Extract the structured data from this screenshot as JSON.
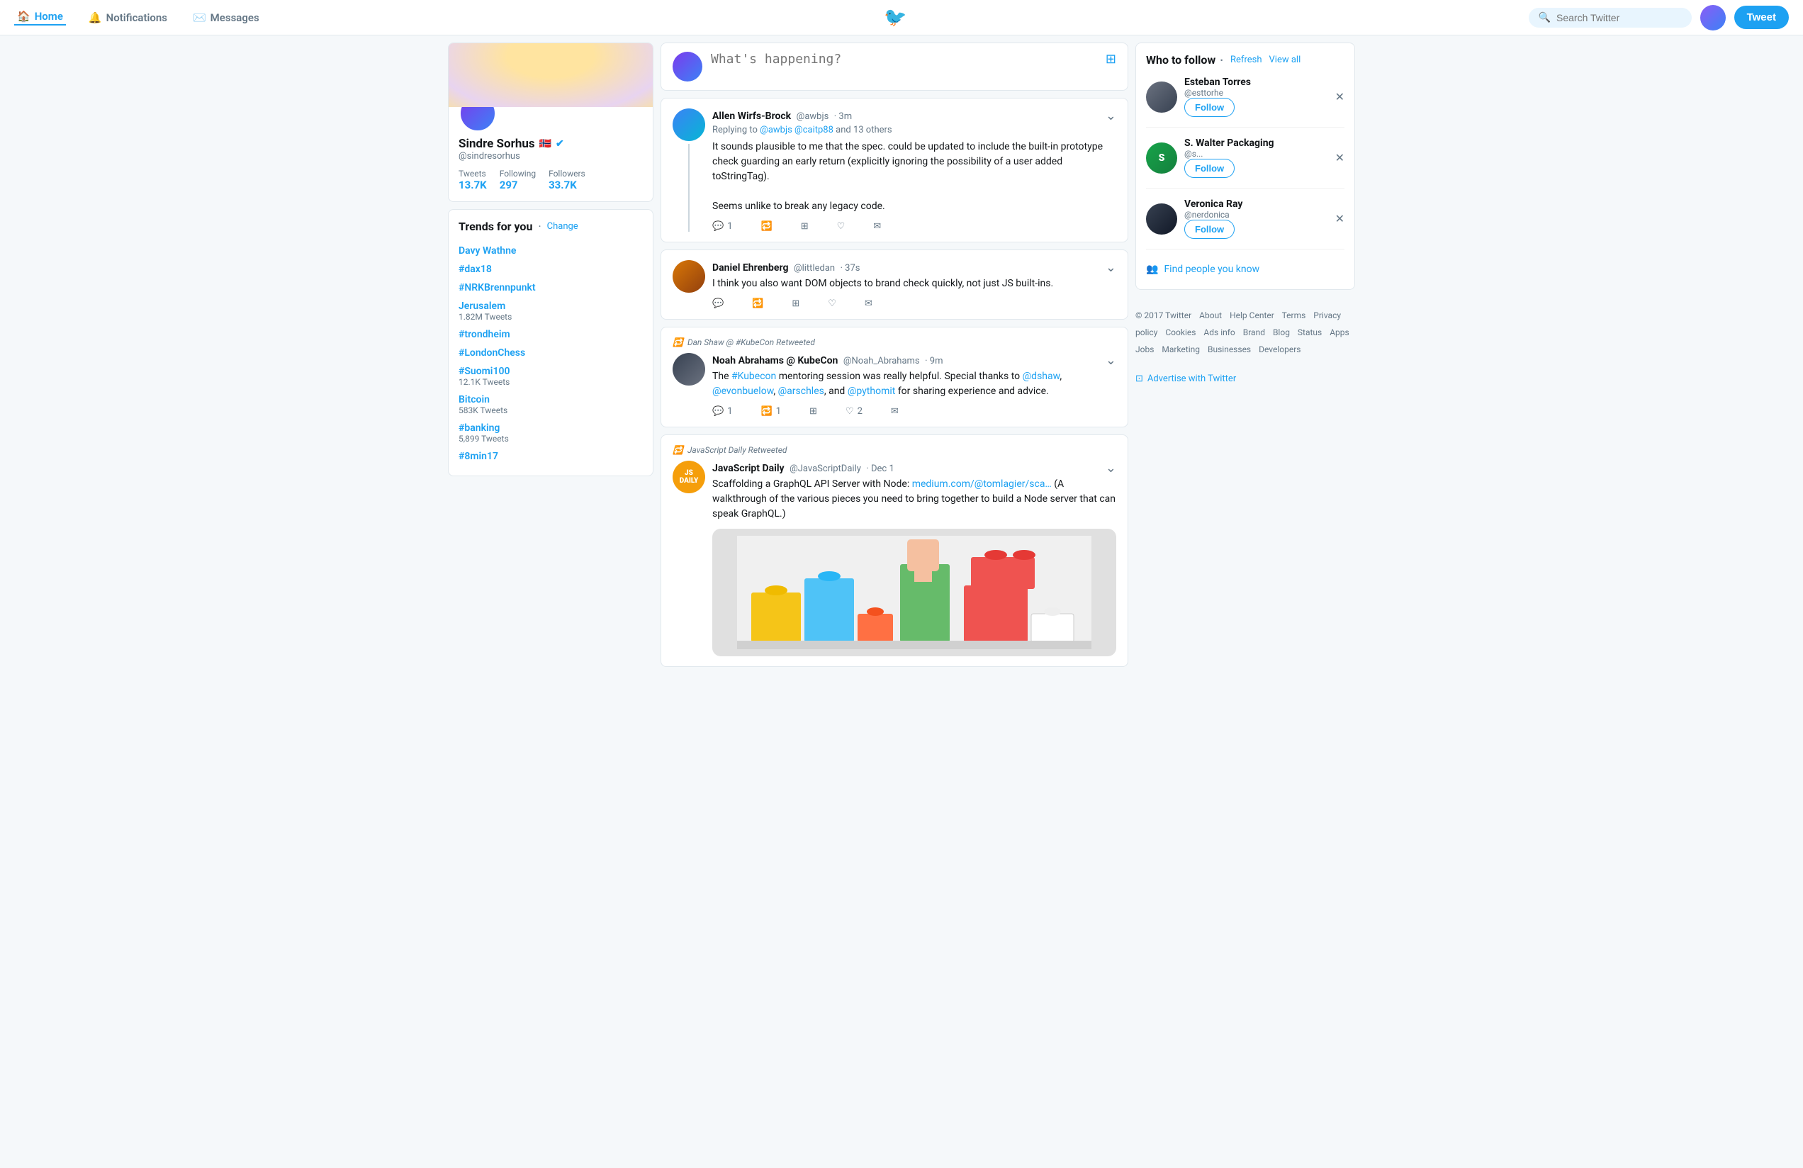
{
  "nav": {
    "home_label": "Home",
    "notifications_label": "Notifications",
    "messages_label": "Messages",
    "search_placeholder": "Search Twitter",
    "tweet_button_label": "Tweet"
  },
  "profile": {
    "name": "Sindre Sorhus",
    "handle": "@sindresorhus",
    "tweets_label": "Tweets",
    "tweets_count": "13.7K",
    "following_label": "Following",
    "following_count": "297",
    "followers_label": "Followers",
    "followers_count": "33.7K"
  },
  "trends": {
    "title": "Trends for you",
    "change_label": "Change",
    "items": [
      {
        "name": "Davy Wathne",
        "count": ""
      },
      {
        "name": "#dax18",
        "count": ""
      },
      {
        "name": "#NRKBrennpunkt",
        "count": ""
      },
      {
        "name": "Jerusalem",
        "count": "1.82M Tweets"
      },
      {
        "name": "#trondheim",
        "count": ""
      },
      {
        "name": "#LondonChess",
        "count": ""
      },
      {
        "name": "#Suomi100",
        "count": "12.1K Tweets"
      },
      {
        "name": "Bitcoin",
        "count": "583K Tweets"
      },
      {
        "name": "#banking",
        "count": "5,899 Tweets"
      },
      {
        "name": "#8min17",
        "count": ""
      }
    ]
  },
  "compose": {
    "placeholder": "What's happening?"
  },
  "tweets": [
    {
      "id": "tweet1",
      "author": "Allen Wirfs-Brock",
      "handle": "@awbjs",
      "time": "3m",
      "reply_to_text": "Replying to @awbjs @caitp88 and 13 others",
      "text": "It sounds plausible to me that the spec. could be updated to include the built-in prototype check guarding an early return (explicitly ignoring the possibility of a user added toStringTag).\n\nSeems unlike to break any legacy code.",
      "replies": "1",
      "retweets": "",
      "likes": "",
      "has_thread": true
    },
    {
      "id": "tweet2",
      "author": "Daniel Ehrenberg",
      "handle": "@littledan",
      "time": "37s",
      "text": "I think you also want DOM objects to brand check quickly, not just JS built-ins.",
      "replies": "",
      "retweets": "",
      "likes": "",
      "has_thread": false
    },
    {
      "id": "tweet3",
      "retweeted_by": "Dan Shaw @ #KubeCon Retweeted",
      "author": "Noah Abrahams @ KubeCon",
      "handle": "@Noah_Abrahams",
      "time": "9m",
      "text": "The #Kubecon mentoring session was really helpful. Special thanks to @dshaw, @evonbuelow, @arschles, and @pythomit for sharing experience and advice.",
      "replies": "1",
      "retweets": "1",
      "likes": "2",
      "has_thread": false
    },
    {
      "id": "tweet4",
      "retweeted_by": "JavaScript Daily Retweeted",
      "author": "JavaScript Daily",
      "handle": "@JavaScriptDaily",
      "time": "Dec 1",
      "text": "Scaffolding a GraphQL API Server with Node: medium.com/@tomlagier/sca… (A walkthrough of the various pieces you need to bring together to build a Node server that can speak GraphQL.)",
      "link_text": "medium.com/@tomlagier/sca…",
      "replies": "",
      "retweets": "",
      "likes": "",
      "has_image": true
    }
  ],
  "who_to_follow": {
    "title": "Who to follow",
    "refresh_label": "Refresh",
    "view_all_label": "View all",
    "find_people_label": "Find people you know",
    "follow_label": "Follow",
    "users": [
      {
        "name": "Esteban Torres",
        "handle": "@esttorhe"
      },
      {
        "name": "S. Walter Packaging",
        "handle": "@s..."
      },
      {
        "name": "Veronica Ray",
        "handle": "@nerdonica"
      }
    ]
  },
  "footer": {
    "links": [
      "© 2017 Twitter",
      "About",
      "Help Center",
      "Terms",
      "Privacy policy",
      "Cookies",
      "Ads info",
      "Brand",
      "Blog",
      "Status",
      "Apps",
      "Jobs",
      "Marketing",
      "Businesses",
      "Developers"
    ],
    "advertise_label": "Advertise with Twitter"
  }
}
